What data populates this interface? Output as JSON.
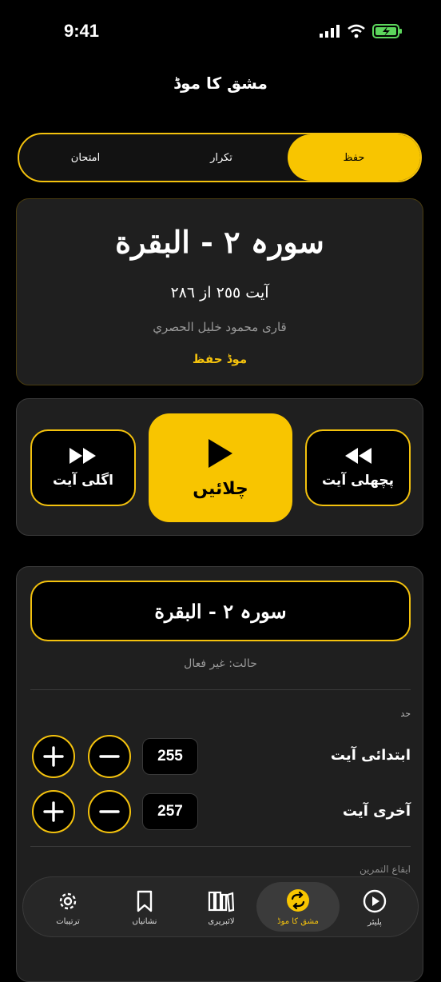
{
  "status_bar": {
    "time": "9:41"
  },
  "header": {
    "title": "مشق کا موڈ"
  },
  "segments": [
    {
      "label": "امتحان"
    },
    {
      "label": "تکرار"
    },
    {
      "label": "حفظ"
    }
  ],
  "info": {
    "surah_title": "سورہ ٢ - البقرة",
    "ayah_line": "آیت ٢٥٥ از ٢٨٦",
    "qari": "قاری محمود خلیل الحصري",
    "mode": "موڈ حفظ"
  },
  "controls": {
    "next_label": "اگلی آیت",
    "play_label": "چلائیں",
    "prev_label": "پچھلی آیت"
  },
  "range": {
    "surah": "سورہ ٢ - البقرة",
    "status": "حالت: غیر فعال",
    "section_label": "حد",
    "start_label": "ابتدائی آیت",
    "start_value": "255",
    "end_label": "آخری آیت",
    "end_value": "257",
    "rhythm_label": "ایقاع التمرین"
  },
  "tabs": [
    {
      "label": "ترتیبات",
      "icon": "gear-icon"
    },
    {
      "label": "نشانیاں",
      "icon": "bookmark-icon"
    },
    {
      "label": "لائبریری",
      "icon": "library-icon"
    },
    {
      "label": "مشق کا موڈ",
      "icon": "repeat-icon",
      "active": true
    },
    {
      "label": "پلیئر",
      "icon": "play-circle-icon"
    }
  ],
  "colors": {
    "accent": "#f8c500",
    "background": "#000000",
    "card": "#1f1f1f"
  }
}
